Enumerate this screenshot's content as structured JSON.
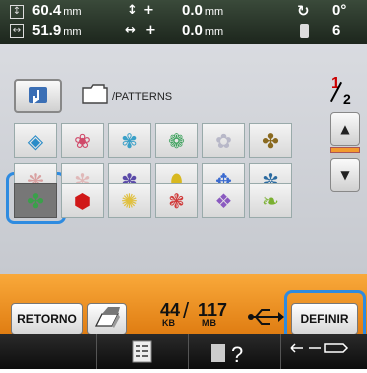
{
  "top_bar": {
    "height": {
      "value": "60.4",
      "unit": "mm",
      "icon": "vertical-size-icon"
    },
    "width": {
      "value": "51.9",
      "unit": "mm",
      "icon": "horizontal-size-icon"
    },
    "move_y": {
      "value": "0.0",
      "unit": "mm",
      "icon": "vertical-move-icon",
      "sign": "+"
    },
    "move_x": {
      "value": "0.0",
      "unit": "mm",
      "icon": "horizontal-move-icon",
      "sign": "+"
    },
    "rotation": {
      "value": "0°",
      "icon": "rotate-icon"
    },
    "color_count": {
      "value": "6",
      "icon": "thread-spool-icon"
    }
  },
  "browser": {
    "path": "/PATTERNS",
    "page_current": "1",
    "page_total": "2"
  },
  "patterns": [
    {
      "icon": "pattern-diamond-blue-icon"
    },
    {
      "icon": "pattern-flower-spray-icon"
    },
    {
      "icon": "pattern-bird-icon"
    },
    {
      "icon": "pattern-green-flower-icon"
    },
    {
      "icon": "pattern-faint-flower-icon"
    },
    {
      "icon": "pattern-gold-ornament-icon"
    },
    {
      "icon": "pattern-pale-rose-icon"
    },
    {
      "icon": "pattern-pale-floral-icon"
    },
    {
      "icon": "pattern-purple-bouquet-icon"
    },
    {
      "icon": "pattern-yellow-egg-icon"
    },
    {
      "icon": "pattern-blue-vine-icon"
    },
    {
      "icon": "pattern-blue-snowflake-icon"
    },
    {
      "icon": "pattern-green-clover-icon"
    },
    {
      "icon": "pattern-red-cube-icon"
    },
    {
      "icon": "pattern-octagon-flower-icon"
    },
    {
      "icon": "pattern-red-floral-icon"
    },
    {
      "icon": "pattern-purple-frame-icon"
    },
    {
      "icon": "pattern-green-swirl-icon"
    }
  ],
  "footer": {
    "retorno_label": "RETORNO",
    "definir_label": "DEFINIR",
    "mem_used": "44",
    "mem_used_unit": "KB",
    "mem_total": "117",
    "mem_total_unit": "MB"
  },
  "colors": {
    "accent_orange": "#f29a2e",
    "highlight_blue": "#2e8be0",
    "page_number_red": "#cc0000"
  }
}
